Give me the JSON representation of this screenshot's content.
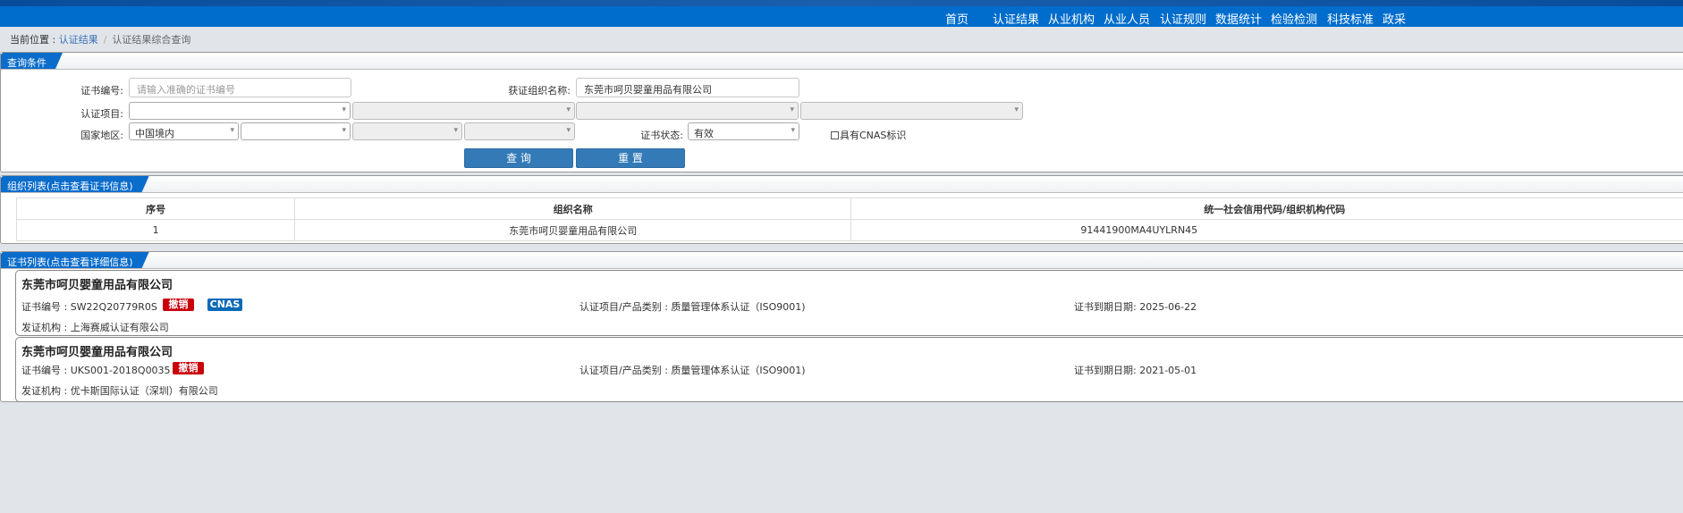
{
  "nav": [
    "首页",
    "认证结果",
    "从业机构",
    "从业人员",
    "认证规则",
    "数据统计",
    "检验检测",
    "科技标准",
    "政采"
  ],
  "breadcrumb": {
    "prefix": "当前位置 :",
    "link": "认证结果",
    "sep": "/",
    "current": "认证结果综合查询"
  },
  "query": {
    "title": "查询条件",
    "cert_no_label": "证书编号:",
    "cert_no_placeholder": "请输入准确的证书编号",
    "org_label": "获证组织名称:",
    "org_value": "东莞市呵贝婴童用品有限公司",
    "item_label": "认证项目:",
    "region_label": "国家地区:",
    "region_value": "中国境内",
    "status_label": "证书状态:",
    "status_value": "有效",
    "cnas_label": "具有CNAS标识",
    "search_btn": "查 询",
    "reset_btn": "重 置"
  },
  "orgs": {
    "title": "组织列表(点击查看证书信息)",
    "headers": [
      "序号",
      "组织名称",
      "统一社会信用代码/组织机构代码"
    ],
    "rows": [
      [
        "1",
        "东莞市呵贝婴童用品有限公司",
        "91441900MA4UYLRN45"
      ]
    ]
  },
  "certs": {
    "title": "证书列表(点击查看详细信息)",
    "items": [
      {
        "name": "东莞市呵贝婴童用品有限公司",
        "cert_no": "证书编号 : SW22Q20779R0S",
        "badge1": "撤销",
        "badge2": "CNAS",
        "item": "认证项目/产品类别 : 质量管理体系认证（ISO9001)",
        "expiry": "证书到期日期: 2025-06-22",
        "issuer": "发证机构 : 上海赛威认证有限公司"
      },
      {
        "name": "东莞市呵贝婴童用品有限公司",
        "cert_no": "证书编号 : UKS001-2018Q0035",
        "badge1": "撤销",
        "item": "认证项目/产品类别 : 质量管理体系认证（ISO9001)",
        "expiry": "证书到期日期: 2021-05-01",
        "issuer": "发证机构 : 优卡斯国际认证（深圳）有限公司"
      }
    ]
  }
}
